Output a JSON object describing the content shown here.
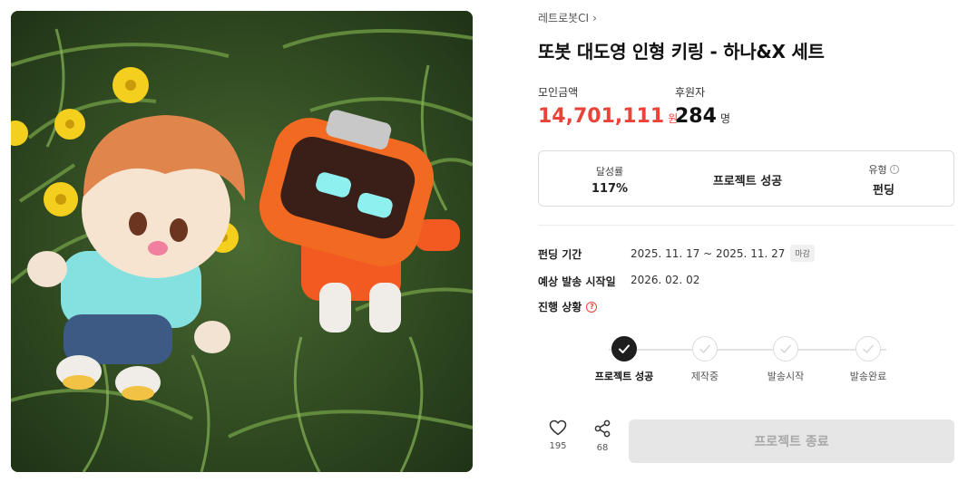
{
  "product": {
    "creator": "레트로봇CI",
    "title": "또봇 대도영 인형 키링 - 하나&X 세트"
  },
  "stats": {
    "amount_label": "모인금액",
    "amount_value": "14,701,111",
    "amount_unit": "원",
    "backers_label": "후원자",
    "backers_value": "284",
    "backers_unit": "명"
  },
  "summary": {
    "achievement_label": "달성률",
    "achievement_value": "117%",
    "status": "프로젝트 성공",
    "type_label": "유형",
    "type_value": "펀딩"
  },
  "details": {
    "period_label": "펀딩 기간",
    "period_value": "2025. 11. 17 ~ 2025. 11. 27",
    "period_badge": "마감",
    "ship_label": "예상 발송 시작일",
    "ship_value": "2026. 02. 02",
    "progress_label": "진행 상황"
  },
  "progress_steps": [
    {
      "label": "프로젝트 성공",
      "done": true
    },
    {
      "label": "제작중",
      "done": false
    },
    {
      "label": "발송시작",
      "done": false
    },
    {
      "label": "발송완료",
      "done": false
    }
  ],
  "actions": {
    "like_count": "195",
    "share_count": "68",
    "end_label": "프로젝트 종료"
  },
  "colors": {
    "accent": "#e8443a",
    "done_step": "#1e1e1e",
    "disabled_button": "#e6e6e6"
  },
  "icons": {
    "creator_chevron": "chevron-right-icon",
    "type_info": "info-icon",
    "progress_help": "question-icon",
    "like": "heart-icon",
    "share": "share-icon",
    "step_check": "check-icon"
  }
}
